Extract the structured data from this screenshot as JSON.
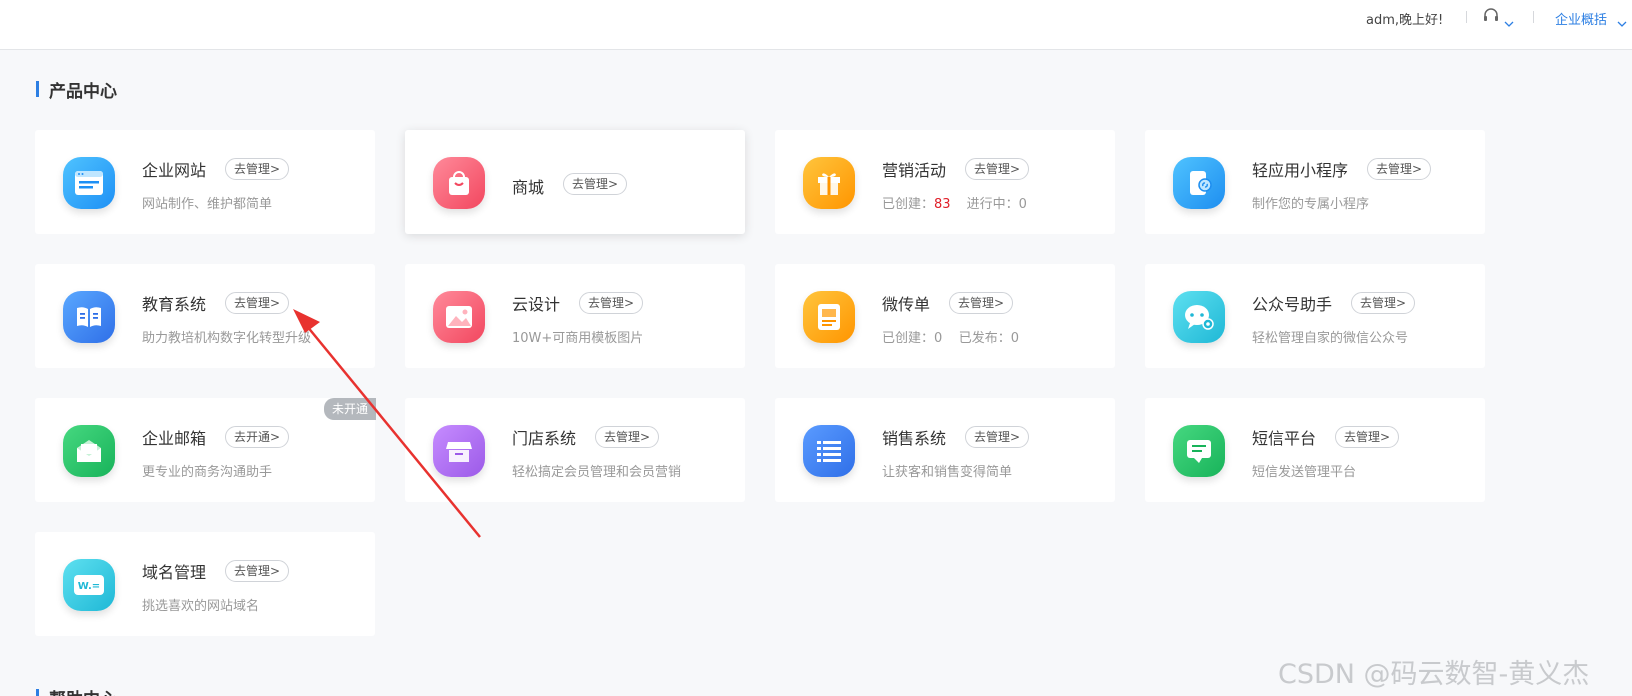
{
  "header": {
    "greeting": "adm,晚上好!",
    "overview": "企业概括"
  },
  "section_product": "产品中心",
  "section_help": "帮助中心",
  "cards": [
    {
      "name": "企业网站",
      "button": "去管理>",
      "desc": "网站制作、维护都简单"
    },
    {
      "name": "商城",
      "button": "去管理>",
      "desc": ""
    },
    {
      "name": "营销活动",
      "button": "去管理>",
      "desc_a": "已创建：",
      "desc_val": "83",
      "desc_b": "进行中：0"
    },
    {
      "name": "轻应用小程序",
      "button": "去管理>",
      "desc": "制作您的专属小程序"
    },
    {
      "name": "教育系统",
      "button": "去管理>",
      "desc": "助力教培机构数字化转型升级"
    },
    {
      "name": "云设计",
      "button": "去管理>",
      "desc": "10W+可商用模板图片"
    },
    {
      "name": "微传单",
      "button": "去管理>",
      "desc": "已创建：0    已发布：0"
    },
    {
      "name": "公众号助手",
      "button": "去管理>",
      "desc": "轻松管理自家的微信公众号"
    },
    {
      "name": "企业邮箱",
      "button": "去开通>",
      "desc": "更专业的商务沟通助手",
      "tag": "未开通"
    },
    {
      "name": "门店系统",
      "button": "去管理>",
      "desc": "轻松搞定会员管理和会员营销"
    },
    {
      "name": "销售系统",
      "button": "去管理>",
      "desc": "让获客和销售变得简单"
    },
    {
      "name": "短信平台",
      "button": "去管理>",
      "desc": "短信发送管理平台"
    },
    {
      "name": "域名管理",
      "button": "去管理>",
      "desc": "挑选喜欢的网站域名"
    }
  ],
  "icons": [
    "website-icon",
    "shop-bag-icon",
    "gift-icon",
    "mini-program-icon",
    "book-icon",
    "image-icon",
    "flyer-icon",
    "wechat-icon",
    "mail-icon",
    "store-icon",
    "list-icon",
    "sms-icon",
    "domain-icon"
  ],
  "colors": {
    "accent": "#2d7fe3",
    "count_red": "#e0202a",
    "arrow_red": "#e8322f"
  },
  "watermark": "CSDN @码云数智-黄义杰"
}
